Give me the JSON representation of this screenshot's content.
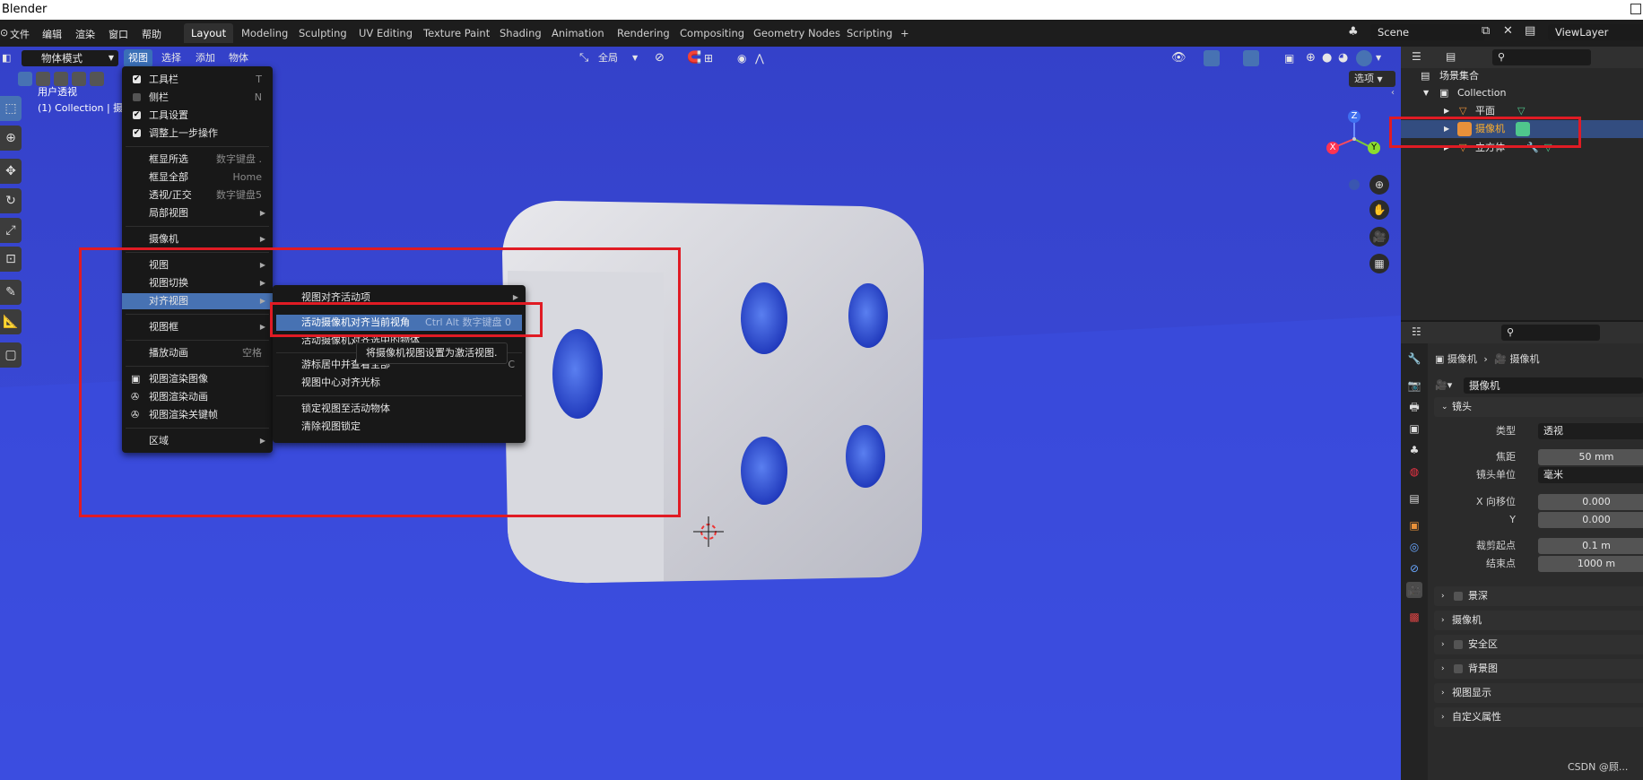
{
  "app": {
    "title": "Blender"
  },
  "topbar": {
    "menus": [
      "文件",
      "编辑",
      "渲染",
      "窗口",
      "帮助"
    ],
    "workspaces": [
      "Layout",
      "Modeling",
      "Sculpting",
      "UV Editing",
      "Texture Paint",
      "Shading",
      "Animation",
      "Rendering",
      "Compositing",
      "Geometry Nodes",
      "Scripting"
    ],
    "active_workspace": "Layout",
    "add_workspace": "+",
    "scene": "Scene",
    "view_layer": "ViewLayer"
  },
  "viewport_header": {
    "mode": "物体模式",
    "menus": [
      "视图",
      "选择",
      "添加",
      "物体"
    ],
    "transform_orientation": "全局",
    "options_label": "选项"
  },
  "viewport": {
    "overlay_line1": "用户透视",
    "overlay_line2": "(1) Collection | 摄像机",
    "gizmo": {
      "x": "X",
      "y": "Y",
      "z": "Z"
    }
  },
  "view_menu": {
    "items": [
      {
        "label": "工具栏",
        "shortcut": "T",
        "check": true
      },
      {
        "label": "侧栏",
        "shortcut": "N",
        "check": false
      },
      {
        "label": "工具设置",
        "shortcut": "",
        "check": true
      },
      {
        "label": "调整上一步操作",
        "shortcut": "",
        "check": true
      },
      {
        "label": "框显所选",
        "shortcut": "数字键盘 ."
      },
      {
        "label": "框显全部",
        "shortcut": "Home"
      },
      {
        "label": "透视/正交",
        "shortcut": "数字键盘5"
      },
      {
        "label": "局部视图",
        "shortcut": "",
        "submenu": true
      },
      {
        "label": "摄像机",
        "shortcut": "",
        "submenu": true
      },
      {
        "label": "视图",
        "shortcut": "",
        "submenu": true
      },
      {
        "label": "视图切换",
        "shortcut": "",
        "submenu": true
      },
      {
        "label": "对齐视图",
        "shortcut": "",
        "submenu": true
      },
      {
        "label": "视图框",
        "shortcut": "",
        "submenu": true
      },
      {
        "label": "播放动画",
        "shortcut": "空格"
      },
      {
        "label": "视图渲染图像",
        "shortcut": ""
      },
      {
        "label": "视图渲染动画",
        "shortcut": ""
      },
      {
        "label": "视图渲染关键帧",
        "shortcut": ""
      },
      {
        "label": "区域",
        "shortcut": "",
        "submenu": true
      }
    ]
  },
  "align_submenu": {
    "items": [
      {
        "label": "视图对齐活动项",
        "shortcut": ""
      },
      {
        "label": "活动摄像机对齐当前视角",
        "shortcut": "Ctrl Alt 数字键盘 0"
      },
      {
        "label": "活动摄像机对齐选中的物体",
        "shortcut": ""
      },
      {
        "label": "游标居中并查看全部",
        "shortcut": "C"
      },
      {
        "label": "视图中心对齐光标",
        "shortcut": ""
      },
      {
        "label": "锁定视图至活动物体",
        "shortcut": ""
      },
      {
        "label": "清除视图锁定",
        "shortcut": ""
      }
    ],
    "tooltip": "将摄像机视图设置为激活视图."
  },
  "outliner": {
    "root": "场景集合",
    "collection": "Collection",
    "objects": [
      "平面",
      "摄像机",
      "立方体"
    ],
    "selected": "摄像机"
  },
  "properties": {
    "breadcrumb_obj": "摄像机",
    "breadcrumb_data": "摄像机",
    "datablock": "摄像机",
    "section": "镜头",
    "type_label": "类型",
    "type_value": "透视",
    "focal_label": "焦距",
    "focal_value": "50 mm",
    "unit_label": "镜头单位",
    "unit_value": "毫米",
    "shiftx_label": "X 向移位",
    "shiftx_value": "0.000",
    "shifty_label": "Y",
    "shifty_value": "0.000",
    "clip_start_label": "裁剪起点",
    "clip_start_value": "0.1 m",
    "clip_end_label": "结束点",
    "clip_end_value": "1000 m",
    "panels": [
      "景深",
      "摄像机",
      "安全区",
      "背景图",
      "视图显示",
      "自定义属性"
    ]
  },
  "watermark": "CSDN @顾..."
}
